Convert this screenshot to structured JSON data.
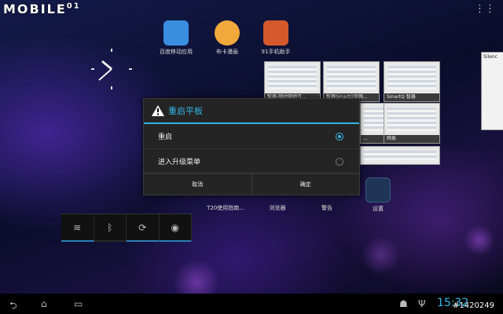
{
  "watermark": {
    "text": "MOBILE",
    "suffix": "01"
  },
  "home_apps": [
    {
      "label": "百度移动应用",
      "color": "#3a8ee0"
    },
    {
      "label": "布卡漫画",
      "color": "#f2a93b"
    },
    {
      "label": "91手机助手",
      "color": "#d45a2c"
    }
  ],
  "dock_apps": [
    {
      "label": "T20使用指南..."
    },
    {
      "label": "浏览器"
    },
    {
      "label": "警告"
    },
    {
      "label": "设置"
    }
  ],
  "recent_thumbs": [
    {
      "label": "智器-随时随地互..."
    },
    {
      "label": "智器SmartQ官网..."
    },
    {
      "label": "SmartQ 智器"
    },
    {
      "label": "..."
    },
    {
      "label": "网易"
    }
  ],
  "side_card": {
    "title": "Silenc"
  },
  "dialog": {
    "title": "重启平板",
    "options": [
      {
        "label": "重启",
        "selected": true
      },
      {
        "label": "进入升级菜单",
        "selected": false
      }
    ],
    "cancel_label": "取消",
    "confirm_label": "确定"
  },
  "status": {
    "time": "15:32",
    "image_id": "#1420249"
  },
  "colors": {
    "accent": "#33b5e5"
  }
}
